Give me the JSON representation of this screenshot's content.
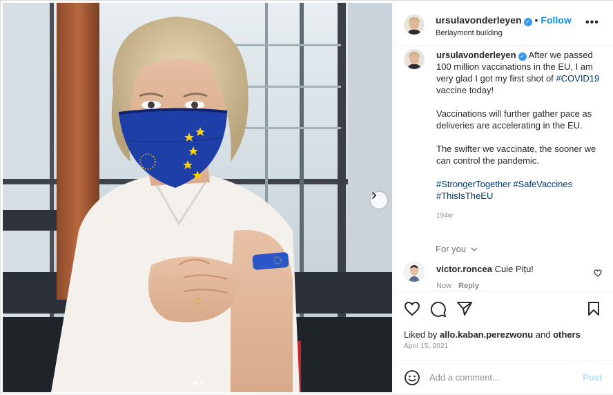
{
  "post": {
    "username": "ursulavonderleyen",
    "follow_label": "Follow",
    "separator": "•",
    "location": "Berlaymont building",
    "more_label": "•••"
  },
  "caption": {
    "username": "ursulavonderleyen",
    "line1": "After we passed 100 million vaccinations in the EU, I am very glad I got my first shot of",
    "hashtag_covid": "#COVID19",
    "line1_end": "vaccine today!",
    "paragraph2": "Vaccinations will further gather pace as deliveries are accelerating in the EU.",
    "paragraph3": "The swifter we vaccinate, the sooner we can control the pandemic.",
    "hashtags": [
      "#StrongerTogether",
      "#SafeVaccines",
      "#ThisIsTheEU"
    ],
    "time_ago": "194w"
  },
  "for_you": {
    "label": "For you"
  },
  "comments": [
    {
      "username": "victor.roncea",
      "text": "Cuie Pițu!",
      "time": "Now",
      "reply_label": "Reply"
    }
  ],
  "likes": {
    "prefix": "Liked by",
    "user": "allo.kaban.perezwonu",
    "connector": "and",
    "others": "others"
  },
  "date": "April 15, 2021",
  "add_comment": {
    "placeholder": "Add a comment...",
    "post_label": "Post"
  },
  "carousel": {
    "total": 2,
    "active": 1
  },
  "icons": {
    "verified": "verified-badge-icon",
    "like": "heart-icon",
    "comment": "comment-bubble-icon",
    "share": "send-icon",
    "save": "bookmark-icon",
    "emoji": "smiley-icon",
    "next": "chevron-right-icon"
  },
  "colors": {
    "accent": "#0095f6",
    "verified": "#3897f0",
    "hashtag": "#00376b",
    "muted": "#8e8e8e",
    "eu_blue": "#1f3fa8",
    "eu_star": "#ffd200"
  }
}
